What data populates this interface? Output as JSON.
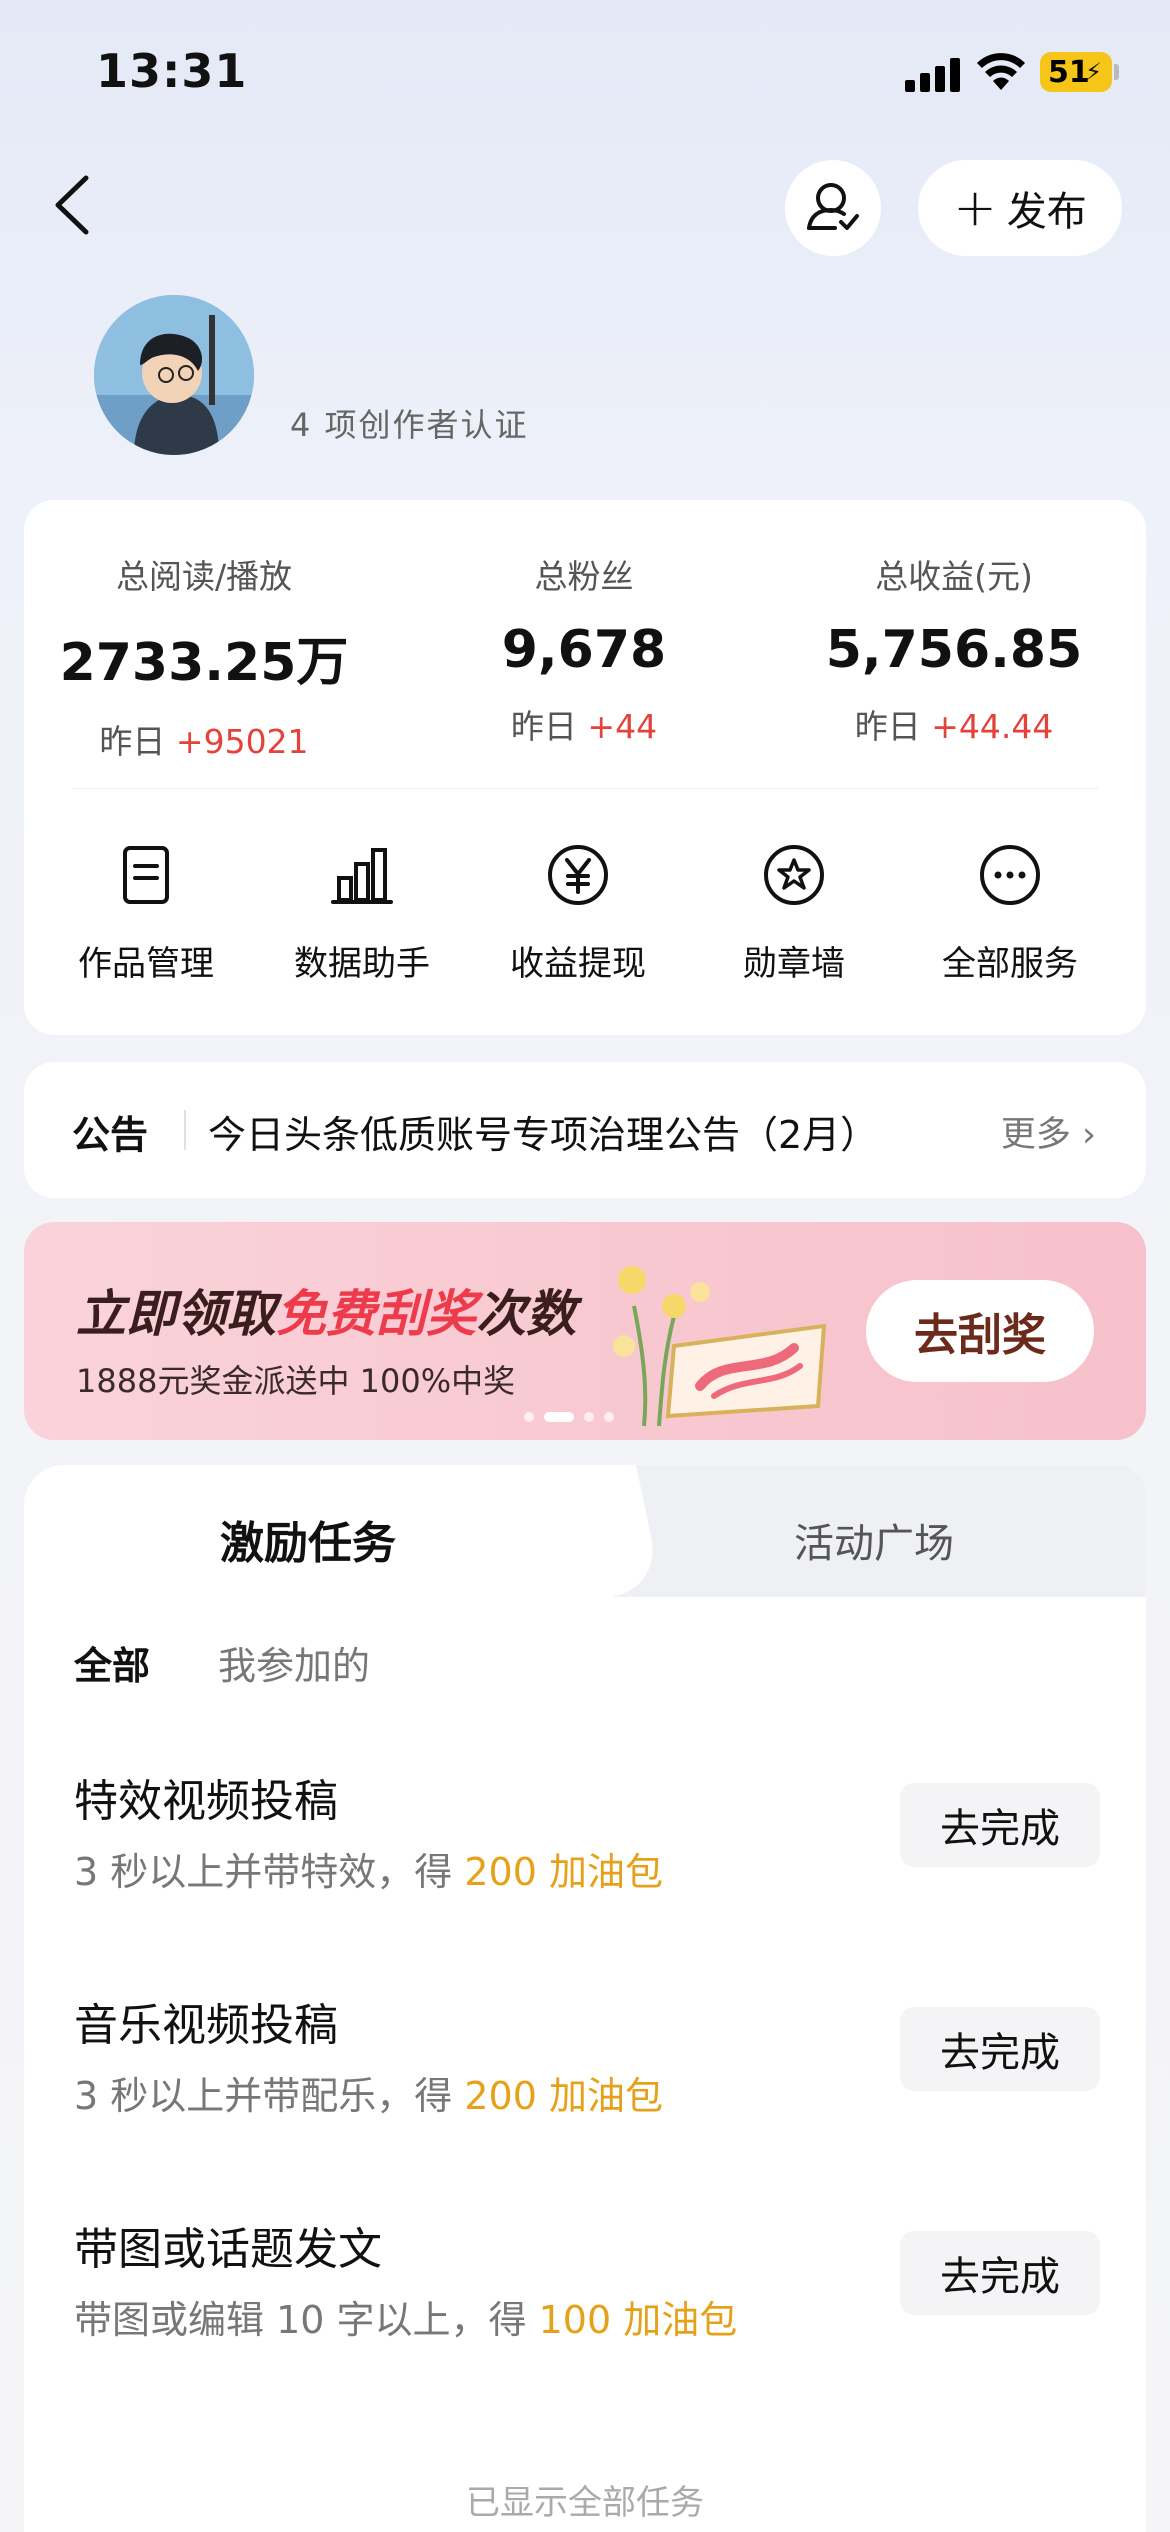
{
  "status": {
    "time": "13:31",
    "battery": "51"
  },
  "nav": {
    "publish_label": "发布"
  },
  "profile": {
    "subtitle": "4 项创作者认证"
  },
  "stats": [
    {
      "label": "总阅读/播放",
      "value": "2733.25万",
      "delta_prefix": "昨日",
      "delta": "+95021"
    },
    {
      "label": "总粉丝",
      "value": "9,678",
      "delta_prefix": "昨日",
      "delta": "+44"
    },
    {
      "label": "总收益(元)",
      "value": "5,756.85",
      "delta_prefix": "昨日",
      "delta": "+44.44"
    }
  ],
  "services": [
    {
      "label": "作品管理",
      "icon": "document-icon"
    },
    {
      "label": "数据助手",
      "icon": "bar-chart-icon"
    },
    {
      "label": "收益提现",
      "icon": "yuan-icon"
    },
    {
      "label": "勋章墙",
      "icon": "badge-icon"
    },
    {
      "label": "全部服务",
      "icon": "more-icon"
    }
  ],
  "notice": {
    "tag": "公告",
    "text": "今日头条低质账号专项治理公告（2月）",
    "more": "更多"
  },
  "banner": {
    "title_pre": "立即领取",
    "title_highlight": "免费刮奖",
    "title_post": "次数",
    "subtitle": "1888元奖金派送中 100%中奖",
    "button": "去刮奖"
  },
  "tasks": {
    "tabs": [
      "激励任务",
      "活动广场"
    ],
    "filters": [
      "全部",
      "我参加的"
    ],
    "items": [
      {
        "title": "特效视频投稿",
        "desc": "3 秒以上并带特效，得 ",
        "reward": "200 加油包",
        "button": "去完成"
      },
      {
        "title": "音乐视频投稿",
        "desc": "3 秒以上并带配乐，得 ",
        "reward": "200 加油包",
        "button": "去完成"
      },
      {
        "title": "带图或话题发文",
        "desc": "带图或编辑 10 字以上，得 ",
        "reward": "100 加油包",
        "button": "去完成"
      }
    ],
    "footer": "已显示全部任务"
  }
}
